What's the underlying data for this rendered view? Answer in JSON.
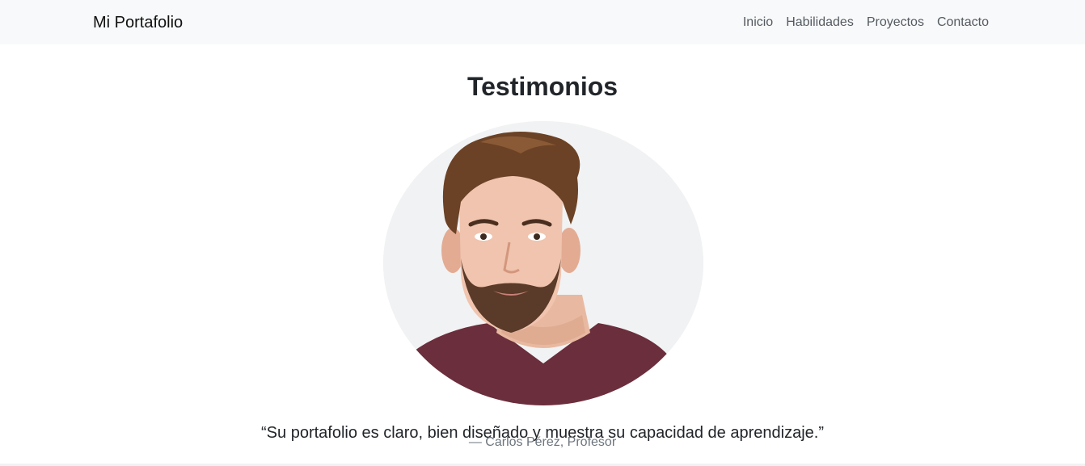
{
  "navbar": {
    "brand": "Mi Portafolio",
    "links": [
      "Inicio",
      "Habilidades",
      "Proyectos",
      "Contacto"
    ]
  },
  "testimonials": {
    "title": "Testimonios",
    "avatar_icon": "person-photo",
    "quote": "“Su portafolio es claro, bien diseñado y muestra su capacidad de aprendizaje.”",
    "author": "— Carlos Pérez, Profesor"
  },
  "colors": {
    "navbar_bg": "#f8f9fa",
    "text": "#212529",
    "muted": "#6c757d",
    "shirt": "#6b2e3c"
  }
}
